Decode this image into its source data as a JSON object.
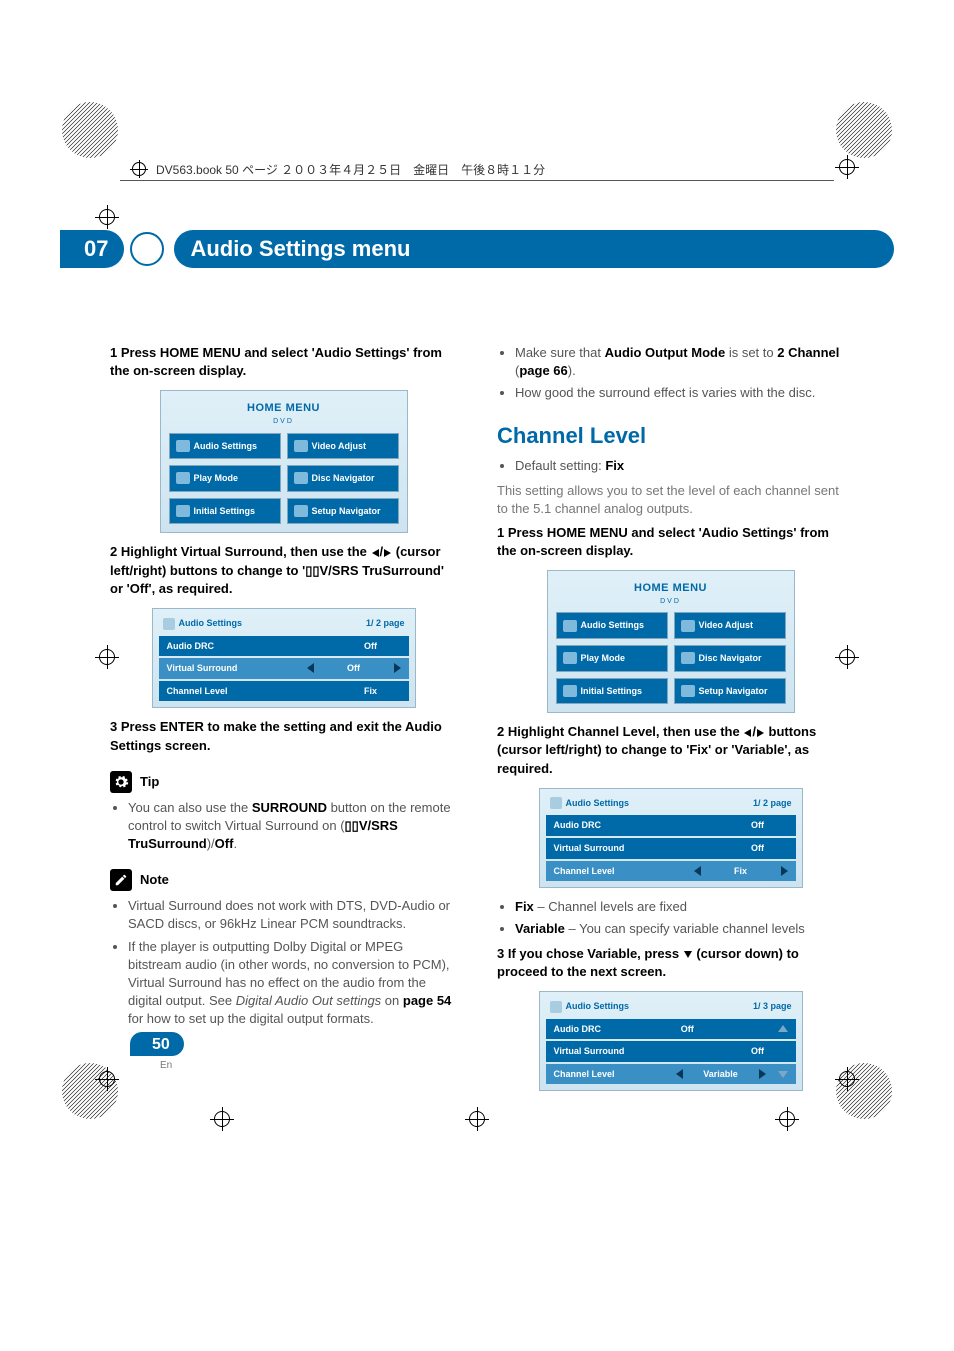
{
  "meta": {
    "filename_line": "DV563.book  50 ページ  ２００３年４月２５日　金曜日　午後８時１１分"
  },
  "chapter": {
    "number": "07",
    "title": "Audio Settings menu"
  },
  "left": {
    "step1": "1    Press HOME MENU and select 'Audio Settings' from the on-screen display.",
    "menu": {
      "title": "HOME MENU",
      "sub": "DVD",
      "b1": "Audio Settings",
      "b2": "Video Adjust",
      "b3": "Play Mode",
      "b4": "Disc Navigator",
      "b5": "Initial Settings",
      "b6": "Setup Navigator"
    },
    "step2_a": "2    Highlight Virtual Surround, then use the ",
    "step2_b": " (cursor left/right) buttons to change to '",
    "step2_c": "V/SRS TruSurround' or 'Off', as required.",
    "panel1": {
      "head": "Audio Settings",
      "page": "1/  2 page",
      "r1": "Audio DRC",
      "v1": "Off",
      "r2": "Virtual Surround",
      "v2": "Off",
      "r3": "Channel Level",
      "v3": "Fix"
    },
    "step3": "3    Press ENTER to make the setting and exit the Audio Settings screen.",
    "tip_label": "Tip",
    "tip_a": "You can also use the ",
    "tip_b": "SURROUND",
    "tip_c": " button on the remote control to switch Virtual Surround on (",
    "tip_d": "V/SRS TruSurround",
    "tip_e": ")/",
    "tip_f": "Off",
    "tip_g": ".",
    "note_label": "Note",
    "note1": "Virtual Surround does not work with DTS, DVD-Audio or SACD discs, or 96kHz Linear PCM soundtracks.",
    "note2_a": "If the player is outputting Dolby Digital or MPEG bitstream audio (in other words, no conversion to PCM), Virtual Surround has no effect on the audio from the digital output. See ",
    "note2_b": "Digital Audio Out settings",
    "note2_c": " on ",
    "note2_d": "page 54",
    "note2_e": " for how to set up the digital output formats."
  },
  "right": {
    "bullet1_a": "Make sure that ",
    "bullet1_b": "Audio Output Mode",
    "bullet1_c": " is set to ",
    "bullet1_d": "2 Channel",
    "bullet1_e": " (",
    "bullet1_f": "page 66",
    "bullet1_g": ").",
    "bullet2": "How good the surround effect is varies with the disc.",
    "h2": "Channel Level",
    "def_a": "Default setting: ",
    "def_b": "Fix",
    "intro": "This setting allows you to set the level of each channel sent to the 5.1 channel analog outputs.",
    "step1": "1    Press HOME MENU and select 'Audio Settings' from the on-screen display.",
    "menu": {
      "title": "HOME MENU",
      "sub": "DVD",
      "b1": "Audio Settings",
      "b2": "Video Adjust",
      "b3": "Play Mode",
      "b4": "Disc Navigator",
      "b5": "Initial Settings",
      "b6": "Setup Navigator"
    },
    "step2_a": "2    Highlight Channel Level, then use the ",
    "step2_b": " buttons (cursor left/right) to change to 'Fix' or 'Variable', as required.",
    "panel2": {
      "head": "Audio Settings",
      "page": "1/  2 page",
      "r1": "Audio DRC",
      "v1": "Off",
      "r2": "Virtual Surround",
      "v2": "Off",
      "r3": "Channel Level",
      "v3": "Fix"
    },
    "fix_a": "Fix",
    "fix_b": " – Channel levels are fixed",
    "var_a": "Variable",
    "var_b": " – You can specify variable channel levels",
    "step3_a": "3    If you chose Variable, press ",
    "step3_b": " (cursor down) to proceed to the next screen.",
    "panel3": {
      "head": "Audio Settings",
      "page": "1/  3 page",
      "r1": "Audio DRC",
      "v1": "Off",
      "r2": "Virtual Surround",
      "v2": "Off",
      "r3": "Channel Level",
      "v3": "Variable"
    }
  },
  "footer": {
    "page": "50",
    "lang": "En"
  }
}
